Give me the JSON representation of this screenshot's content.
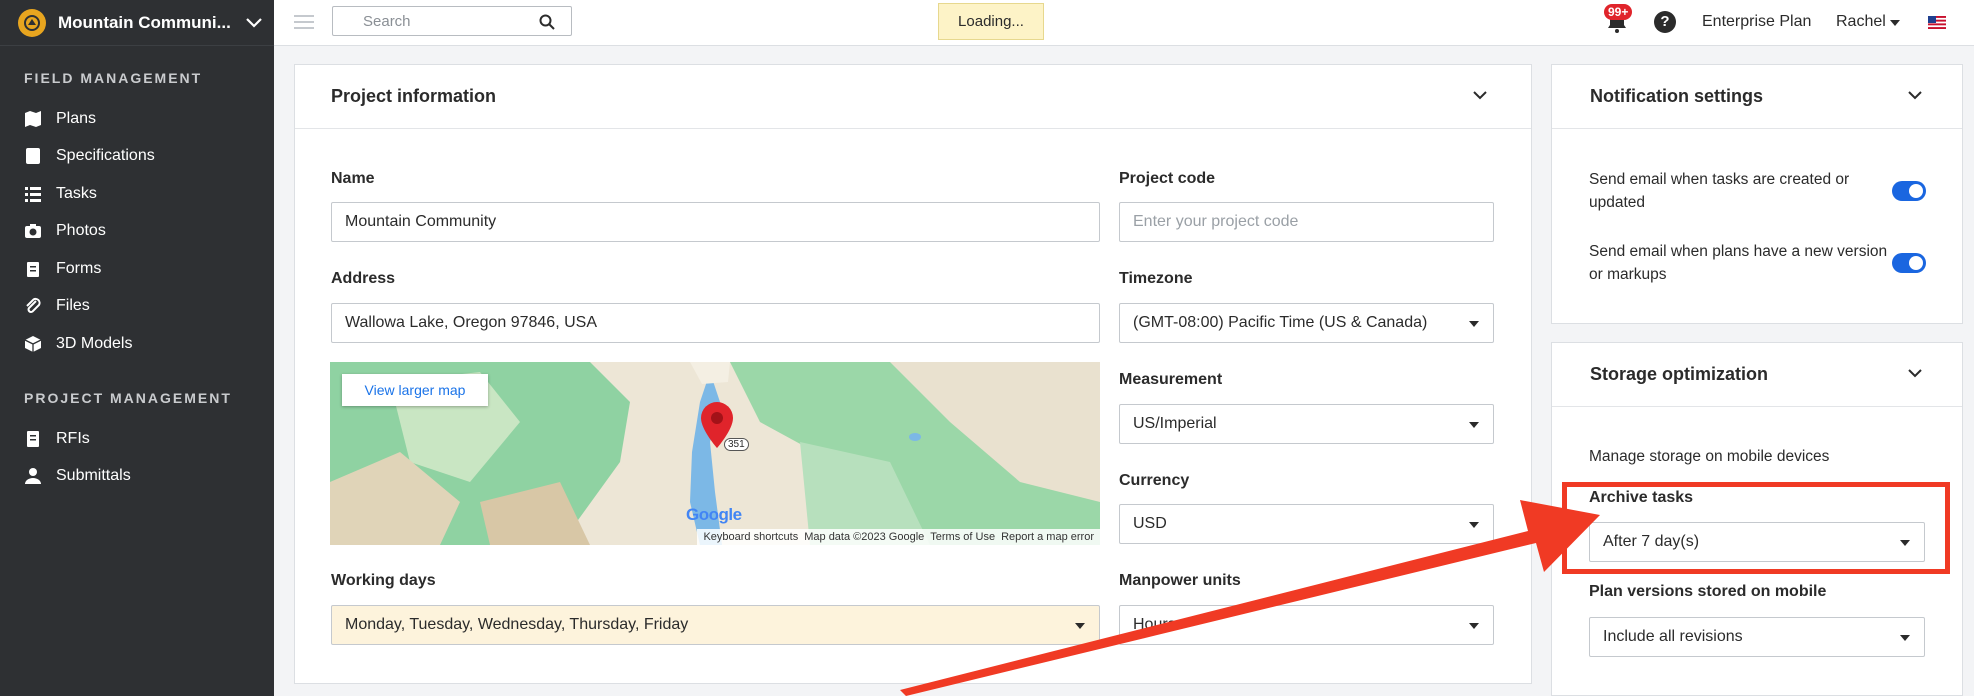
{
  "sidebar": {
    "project_name": "Mountain Communi...",
    "sections": [
      {
        "title": "FIELD MANAGEMENT",
        "items": [
          {
            "label": "Plans",
            "icon": "map-icon"
          },
          {
            "label": "Specifications",
            "icon": "book-icon"
          },
          {
            "label": "Tasks",
            "icon": "list-icon"
          },
          {
            "label": "Photos",
            "icon": "camera-icon"
          },
          {
            "label": "Forms",
            "icon": "clipboard-icon"
          },
          {
            "label": "Files",
            "icon": "paperclip-icon"
          },
          {
            "label": "3D Models",
            "icon": "cube-icon"
          }
        ]
      },
      {
        "title": "PROJECT MANAGEMENT",
        "items": [
          {
            "label": "RFIs",
            "icon": "document-icon"
          },
          {
            "label": "Submittals",
            "icon": "user-icon"
          }
        ]
      }
    ]
  },
  "topbar": {
    "search_placeholder": "Search",
    "loading": "Loading...",
    "notification_count": "99+",
    "help": "?",
    "plan": "Enterprise Plan",
    "user": "Rachel"
  },
  "project_info": {
    "title": "Project information",
    "name_label": "Name",
    "name_value": "Mountain Community",
    "code_label": "Project code",
    "code_placeholder": "Enter your project code",
    "address_label": "Address",
    "address_value": "Wallowa Lake, Oregon 97846, USA",
    "timezone_label": "Timezone",
    "timezone_value": "(GMT-08:00) Pacific Time (US & Canada)",
    "measurement_label": "Measurement",
    "measurement_value": "US/Imperial",
    "currency_label": "Currency",
    "currency_value": "USD",
    "working_days_label": "Working days",
    "working_days_value": "Monday, Tuesday, Wednesday, Thursday, Friday",
    "manpower_label": "Manpower units",
    "manpower_value": "Hours"
  },
  "map": {
    "view_larger": "View larger map",
    "route": "351",
    "logo": "Google",
    "attribution": [
      "Keyboard shortcuts",
      "Map data ©2023 Google",
      "Terms of Use",
      "Report a map error"
    ]
  },
  "notifications": {
    "title": "Notification settings",
    "items": [
      {
        "text": "Send email when tasks are created or updated",
        "enabled": true
      },
      {
        "text": "Send email when plans have a new version or markups",
        "enabled": true
      }
    ]
  },
  "storage": {
    "title": "Storage optimization",
    "description": "Manage storage on mobile devices",
    "archive_label": "Archive tasks",
    "archive_value": "After 7 day(s)",
    "plan_versions_label": "Plan versions stored on mobile",
    "plan_versions_value": "Include all revisions"
  },
  "colors": {
    "sidebar_bg": "#2e3033",
    "accent_blue": "#1a66e0",
    "highlight_red": "#f03a24",
    "loading_bg": "#fdf3c7"
  }
}
